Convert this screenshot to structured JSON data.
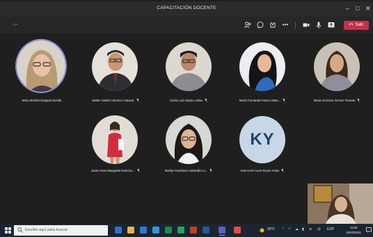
{
  "window": {
    "title": "CAPACITACIÓN DOCENTE",
    "minimize_glyph": "–",
    "maximize_glyph": "□",
    "close_glyph": "✕"
  },
  "toolbar": {
    "meeting_timer_glyph": "-○-",
    "more_glyph": "•••",
    "leave_label": "Salir",
    "icons": [
      "people-icon",
      "chat-icon",
      "reactions-icon",
      "more-icon",
      "camera-icon",
      "mic-icon",
      "share-icon",
      "phone-icon"
    ],
    "leave_color": "#c4314b"
  },
  "participants": [
    {
      "name": "Betty Maribel Delgado Bonilla",
      "muted": false,
      "speaking": true
    },
    {
      "name": "Walter Gabriel Jimenez Salazar",
      "muted": true
    },
    {
      "name": "Carlos Luis Mejía Lindao",
      "muted": true
    },
    {
      "name": "María Fernanda Franco Mata...",
      "muted": true
    },
    {
      "name": "Maria Veronica Gomez Poveda",
      "muted": true
    },
    {
      "name": "Juana Rosa Margarita Ramírez...",
      "muted": true
    },
    {
      "name": "Marilyn Estefania Cabanilla Lo...",
      "muted": true
    },
    {
      "name": "Karina Del rocio Reyes Yulan",
      "muted": true,
      "initials": "KY"
    }
  ],
  "taskbar": {
    "search_placeholder": "Escribe aquí para buscar",
    "weather": "26°C",
    "language": "ESP",
    "time": "11:00",
    "date": "18/10/2021",
    "accent": "#7cc0ff"
  }
}
